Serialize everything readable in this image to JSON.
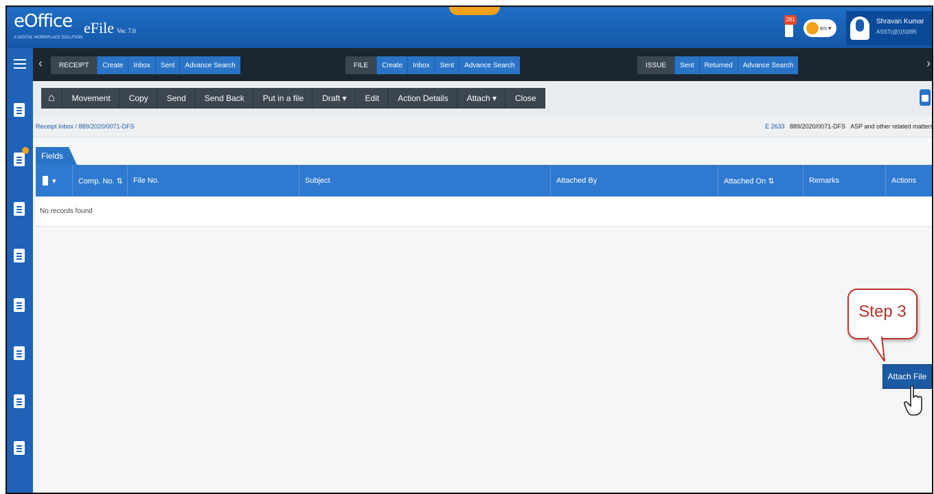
{
  "header": {
    "logo_text": "eOffice",
    "logo_tagline": "A DIGITAL WORKPLACE SOLUTION",
    "app_name": "eFile",
    "app_version": "Ver. 7.0",
    "notification_count": "281",
    "language": "en",
    "user": {
      "name": "Shravan Kumar",
      "designation": "ASST(@)15|095"
    }
  },
  "menubar": {
    "receipt": {
      "label": "RECEIPT",
      "options": [
        "Create",
        "Inbox",
        "Sent",
        "Advance Search"
      ]
    },
    "file": {
      "label": "FILE",
      "options": [
        "Create",
        "Inbox",
        "Sent",
        "Advance Search"
      ]
    },
    "issue": {
      "label": "ISSUE",
      "options": [
        "Sent",
        "Returned",
        "Advance Search"
      ]
    }
  },
  "toolbar": {
    "buttons": [
      "Movement",
      "Copy",
      "Send",
      "Send Back",
      "Put in a file",
      "Draft ▾",
      "Edit",
      "Action Details",
      "Attach ▾",
      "Close"
    ]
  },
  "breadcrumb": {
    "text": "Receipt Inbox / 889/2020/0071-DFS",
    "right_num": "E 2633",
    "right_file": "889/2020/0071-DFS",
    "right_subject": "ASP and other related matters"
  },
  "content": {
    "tab_label": "Fields",
    "columns": [
      "Comp. No. ⇅",
      "File No.",
      "Subject",
      "Attached By",
      "Attached On ⇅",
      "Remarks",
      "Actions"
    ],
    "empty_message": "No records found"
  },
  "callout": {
    "text": "Step 3"
  },
  "attach_button": {
    "label": "Attach File"
  }
}
